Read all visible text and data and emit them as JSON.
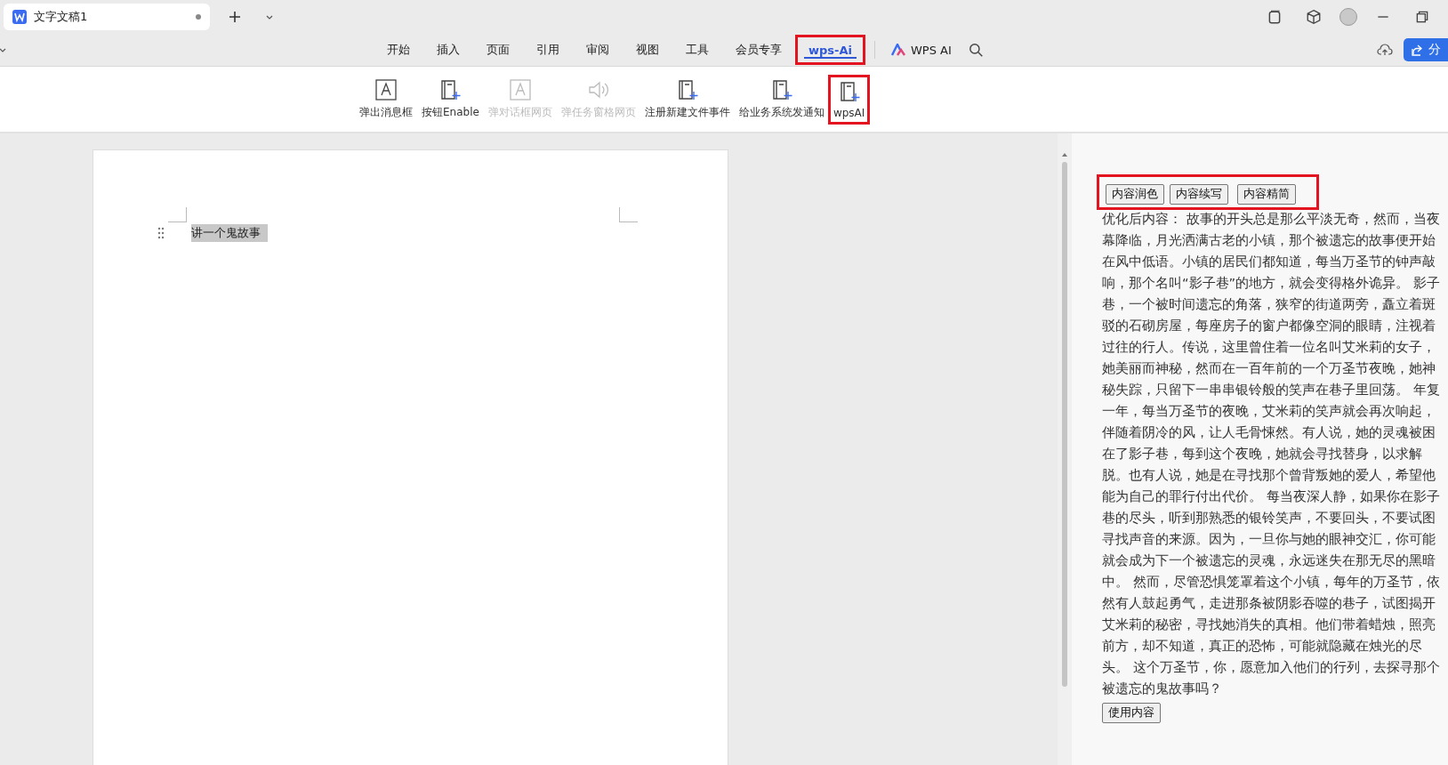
{
  "tab": {
    "title": "文字文稿1",
    "unsaved": true
  },
  "menu": [
    {
      "label": "开始",
      "selected": false
    },
    {
      "label": "插入",
      "selected": false
    },
    {
      "label": "页面",
      "selected": false
    },
    {
      "label": "引用",
      "selected": false
    },
    {
      "label": "审阅",
      "selected": false
    },
    {
      "label": "视图",
      "selected": false
    },
    {
      "label": "工具",
      "selected": false
    },
    {
      "label": "会员专享",
      "selected": false
    },
    {
      "label": "wps-Ai",
      "selected": true,
      "highlighted": true
    }
  ],
  "ai_button": {
    "label": "WPS AI"
  },
  "share_button": {
    "label": "分"
  },
  "toolbar": [
    {
      "label": "弹出消息框",
      "kind": "frame",
      "disabled": false,
      "highlighted": false
    },
    {
      "label": "按钮Enable",
      "kind": "book",
      "disabled": false,
      "highlighted": false
    },
    {
      "label": "弹对话框网页",
      "kind": "frame",
      "disabled": true,
      "highlighted": false
    },
    {
      "label": "弹任务窗格网页",
      "kind": "speaker",
      "disabled": true,
      "highlighted": false
    },
    {
      "label": "注册新建文件事件",
      "kind": "book",
      "disabled": false,
      "highlighted": false
    },
    {
      "label": "给业务系统发通知",
      "kind": "book",
      "disabled": false,
      "highlighted": false
    },
    {
      "label": "wpsAI",
      "kind": "book",
      "disabled": false,
      "highlighted": true
    }
  ],
  "document": {
    "paragraph": "讲一个鬼故事",
    "selected": true
  },
  "panel": {
    "actions_highlighted": true,
    "actions": [
      "内容润色",
      "内容续写",
      "内容精简"
    ],
    "result": "优化后内容： 故事的开头总是那么平淡无奇，然而，当夜幕降临，月光洒满古老的小镇，那个被遗忘的故事便开始在风中低语。小镇的居民们都知道，每当万圣节的钟声敲响，那个名叫“影子巷”的地方，就会变得格外诡异。 影子巷，一个被时间遗忘的角落，狭窄的街道两旁，矗立着斑驳的石砌房屋，每座房子的窗户都像空洞的眼睛，注视着过往的行人。传说，这里曾住着一位名叫艾米莉的女子，她美丽而神秘，然而在一百年前的一个万圣节夜晚，她神秘失踪，只留下一串串银铃般的笑声在巷子里回荡。 年复一年，每当万圣节的夜晚，艾米莉的笑声就会再次响起，伴随着阴冷的风，让人毛骨悚然。有人说，她的灵魂被困在了影子巷，每到这个夜晚，她就会寻找替身，以求解脱。也有人说，她是在寻找那个曾背叛她的爱人，希望他能为自己的罪行付出代价。 每当夜深人静，如果你在影子巷的尽头，听到那熟悉的银铃笑声，不要回头，不要试图寻找声音的来源。因为，一旦你与她的眼神交汇，你可能就会成为下一个被遗忘的灵魂，永远迷失在那无尽的黑暗中。 然而，尽管恐惧笼罩着这个小镇，每年的万圣节，依然有人鼓起勇气，走进那条被阴影吞噬的巷子，试图揭开艾米莉的秘密，寻找她消失的真相。他们带着蜡烛，照亮前方，却不知道，真正的恐怖，可能就隐藏在烛光的尽头。 这个万圣节，你，愿意加入他们的行列，去探寻那个被遗忘的鬼故事吗？",
    "use_button": "使用内容"
  }
}
